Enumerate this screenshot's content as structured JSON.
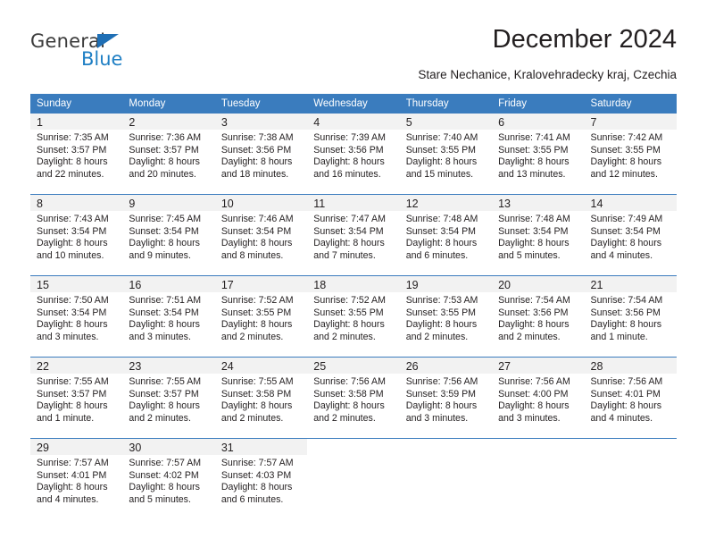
{
  "brand": {
    "name_part1": "General",
    "name_part2": "Blue",
    "triangle_color": "#1f6fb5",
    "blue_color": "#1f7fc4"
  },
  "header": {
    "title": "December 2024",
    "subtitle": "Stare Nechanice, Kralovehradecky kraj, Czechia"
  },
  "theme": {
    "header_bg": "#3a7cbe",
    "daynum_bg": "#f2f2f2",
    "text": "#231f20"
  },
  "calendar": {
    "weekday_headers": [
      "Sunday",
      "Monday",
      "Tuesday",
      "Wednesday",
      "Thursday",
      "Friday",
      "Saturday"
    ],
    "weeks": [
      [
        {
          "day": "1",
          "sunrise": "Sunrise: 7:35 AM",
          "sunset": "Sunset: 3:57 PM",
          "daylight1": "Daylight: 8 hours",
          "daylight2": "and 22 minutes."
        },
        {
          "day": "2",
          "sunrise": "Sunrise: 7:36 AM",
          "sunset": "Sunset: 3:57 PM",
          "daylight1": "Daylight: 8 hours",
          "daylight2": "and 20 minutes."
        },
        {
          "day": "3",
          "sunrise": "Sunrise: 7:38 AM",
          "sunset": "Sunset: 3:56 PM",
          "daylight1": "Daylight: 8 hours",
          "daylight2": "and 18 minutes."
        },
        {
          "day": "4",
          "sunrise": "Sunrise: 7:39 AM",
          "sunset": "Sunset: 3:56 PM",
          "daylight1": "Daylight: 8 hours",
          "daylight2": "and 16 minutes."
        },
        {
          "day": "5",
          "sunrise": "Sunrise: 7:40 AM",
          "sunset": "Sunset: 3:55 PM",
          "daylight1": "Daylight: 8 hours",
          "daylight2": "and 15 minutes."
        },
        {
          "day": "6",
          "sunrise": "Sunrise: 7:41 AM",
          "sunset": "Sunset: 3:55 PM",
          "daylight1": "Daylight: 8 hours",
          "daylight2": "and 13 minutes."
        },
        {
          "day": "7",
          "sunrise": "Sunrise: 7:42 AM",
          "sunset": "Sunset: 3:55 PM",
          "daylight1": "Daylight: 8 hours",
          "daylight2": "and 12 minutes."
        }
      ],
      [
        {
          "day": "8",
          "sunrise": "Sunrise: 7:43 AM",
          "sunset": "Sunset: 3:54 PM",
          "daylight1": "Daylight: 8 hours",
          "daylight2": "and 10 minutes."
        },
        {
          "day": "9",
          "sunrise": "Sunrise: 7:45 AM",
          "sunset": "Sunset: 3:54 PM",
          "daylight1": "Daylight: 8 hours",
          "daylight2": "and 9 minutes."
        },
        {
          "day": "10",
          "sunrise": "Sunrise: 7:46 AM",
          "sunset": "Sunset: 3:54 PM",
          "daylight1": "Daylight: 8 hours",
          "daylight2": "and 8 minutes."
        },
        {
          "day": "11",
          "sunrise": "Sunrise: 7:47 AM",
          "sunset": "Sunset: 3:54 PM",
          "daylight1": "Daylight: 8 hours",
          "daylight2": "and 7 minutes."
        },
        {
          "day": "12",
          "sunrise": "Sunrise: 7:48 AM",
          "sunset": "Sunset: 3:54 PM",
          "daylight1": "Daylight: 8 hours",
          "daylight2": "and 6 minutes."
        },
        {
          "day": "13",
          "sunrise": "Sunrise: 7:48 AM",
          "sunset": "Sunset: 3:54 PM",
          "daylight1": "Daylight: 8 hours",
          "daylight2": "and 5 minutes."
        },
        {
          "day": "14",
          "sunrise": "Sunrise: 7:49 AM",
          "sunset": "Sunset: 3:54 PM",
          "daylight1": "Daylight: 8 hours",
          "daylight2": "and 4 minutes."
        }
      ],
      [
        {
          "day": "15",
          "sunrise": "Sunrise: 7:50 AM",
          "sunset": "Sunset: 3:54 PM",
          "daylight1": "Daylight: 8 hours",
          "daylight2": "and 3 minutes."
        },
        {
          "day": "16",
          "sunrise": "Sunrise: 7:51 AM",
          "sunset": "Sunset: 3:54 PM",
          "daylight1": "Daylight: 8 hours",
          "daylight2": "and 3 minutes."
        },
        {
          "day": "17",
          "sunrise": "Sunrise: 7:52 AM",
          "sunset": "Sunset: 3:55 PM",
          "daylight1": "Daylight: 8 hours",
          "daylight2": "and 2 minutes."
        },
        {
          "day": "18",
          "sunrise": "Sunrise: 7:52 AM",
          "sunset": "Sunset: 3:55 PM",
          "daylight1": "Daylight: 8 hours",
          "daylight2": "and 2 minutes."
        },
        {
          "day": "19",
          "sunrise": "Sunrise: 7:53 AM",
          "sunset": "Sunset: 3:55 PM",
          "daylight1": "Daylight: 8 hours",
          "daylight2": "and 2 minutes."
        },
        {
          "day": "20",
          "sunrise": "Sunrise: 7:54 AM",
          "sunset": "Sunset: 3:56 PM",
          "daylight1": "Daylight: 8 hours",
          "daylight2": "and 2 minutes."
        },
        {
          "day": "21",
          "sunrise": "Sunrise: 7:54 AM",
          "sunset": "Sunset: 3:56 PM",
          "daylight1": "Daylight: 8 hours",
          "daylight2": "and 1 minute."
        }
      ],
      [
        {
          "day": "22",
          "sunrise": "Sunrise: 7:55 AM",
          "sunset": "Sunset: 3:57 PM",
          "daylight1": "Daylight: 8 hours",
          "daylight2": "and 1 minute."
        },
        {
          "day": "23",
          "sunrise": "Sunrise: 7:55 AM",
          "sunset": "Sunset: 3:57 PM",
          "daylight1": "Daylight: 8 hours",
          "daylight2": "and 2 minutes."
        },
        {
          "day": "24",
          "sunrise": "Sunrise: 7:55 AM",
          "sunset": "Sunset: 3:58 PM",
          "daylight1": "Daylight: 8 hours",
          "daylight2": "and 2 minutes."
        },
        {
          "day": "25",
          "sunrise": "Sunrise: 7:56 AM",
          "sunset": "Sunset: 3:58 PM",
          "daylight1": "Daylight: 8 hours",
          "daylight2": "and 2 minutes."
        },
        {
          "day": "26",
          "sunrise": "Sunrise: 7:56 AM",
          "sunset": "Sunset: 3:59 PM",
          "daylight1": "Daylight: 8 hours",
          "daylight2": "and 3 minutes."
        },
        {
          "day": "27",
          "sunrise": "Sunrise: 7:56 AM",
          "sunset": "Sunset: 4:00 PM",
          "daylight1": "Daylight: 8 hours",
          "daylight2": "and 3 minutes."
        },
        {
          "day": "28",
          "sunrise": "Sunrise: 7:56 AM",
          "sunset": "Sunset: 4:01 PM",
          "daylight1": "Daylight: 8 hours",
          "daylight2": "and 4 minutes."
        }
      ],
      [
        {
          "day": "29",
          "sunrise": "Sunrise: 7:57 AM",
          "sunset": "Sunset: 4:01 PM",
          "daylight1": "Daylight: 8 hours",
          "daylight2": "and 4 minutes."
        },
        {
          "day": "30",
          "sunrise": "Sunrise: 7:57 AM",
          "sunset": "Sunset: 4:02 PM",
          "daylight1": "Daylight: 8 hours",
          "daylight2": "and 5 minutes."
        },
        {
          "day": "31",
          "sunrise": "Sunrise: 7:57 AM",
          "sunset": "Sunset: 4:03 PM",
          "daylight1": "Daylight: 8 hours",
          "daylight2": "and 6 minutes."
        },
        {
          "day": "",
          "sunrise": "",
          "sunset": "",
          "daylight1": "",
          "daylight2": ""
        },
        {
          "day": "",
          "sunrise": "",
          "sunset": "",
          "daylight1": "",
          "daylight2": ""
        },
        {
          "day": "",
          "sunrise": "",
          "sunset": "",
          "daylight1": "",
          "daylight2": ""
        },
        {
          "day": "",
          "sunrise": "",
          "sunset": "",
          "daylight1": "",
          "daylight2": ""
        }
      ]
    ]
  }
}
